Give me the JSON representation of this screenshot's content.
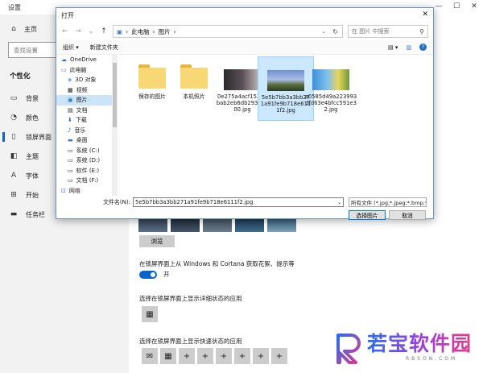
{
  "settings": {
    "title": "设置",
    "home": "主页",
    "search_placeholder": "查找设置",
    "section": "个性化",
    "nav": [
      {
        "label": "背景",
        "icon": "image-icon"
      },
      {
        "label": "颜色",
        "icon": "palette-icon"
      },
      {
        "label": "锁屏界面",
        "icon": "lock-screen-icon"
      },
      {
        "label": "主题",
        "icon": "theme-icon"
      },
      {
        "label": "字体",
        "icon": "font-icon"
      },
      {
        "label": "开始",
        "icon": "start-icon"
      },
      {
        "label": "任务栏",
        "icon": "taskbar-icon"
      }
    ],
    "browse": "浏览",
    "cortana_option": "在锁屏界面上从 Windows 和 Cortana 获取花絮、提示等",
    "toggle_state": "开",
    "detailed_status": "选择在锁屏界面上显示详细状态的应用",
    "quick_status": "选择在锁屏界面上显示快速状态的应用",
    "quick_slots": [
      "+",
      "+",
      "+",
      "+",
      "+",
      "+"
    ]
  },
  "dialog": {
    "title": "打开",
    "path": [
      "此电脑",
      "图片"
    ],
    "search_placeholder": "在 图片 中搜索",
    "organize": "组织 ▾",
    "new_folder": "新建文件夹",
    "nav_items": [
      {
        "label": "OneDrive",
        "icon": "cloud-icon"
      },
      {
        "label": "此电脑",
        "icon": "computer-icon"
      },
      {
        "label": "3D 对象",
        "icon": "cube-icon"
      },
      {
        "label": "视频",
        "icon": "video-icon"
      },
      {
        "label": "图片",
        "icon": "pictures-icon"
      },
      {
        "label": "文档",
        "icon": "document-icon"
      },
      {
        "label": "下载",
        "icon": "download-icon"
      },
      {
        "label": "音乐",
        "icon": "music-icon"
      },
      {
        "label": "桌面",
        "icon": "desktop-icon"
      },
      {
        "label": "系统 (C:)",
        "icon": "drive-icon"
      },
      {
        "label": "系统 (D:)",
        "icon": "drive-icon"
      },
      {
        "label": "软件 (E:)",
        "icon": "drive-icon"
      },
      {
        "label": "文档 (F:)",
        "icon": "drive-icon"
      },
      {
        "label": "网络",
        "icon": "network-icon"
      }
    ],
    "files": [
      {
        "name": "保存的图片",
        "type": "folder"
      },
      {
        "name": "本机照片",
        "type": "folder"
      },
      {
        "name": "0e275a4acf15273bab2eb6db2939a300.jpg",
        "type": "photo"
      },
      {
        "name": "5e5b7bb3a3bb271a91fe9b718e6111f2.jpg",
        "type": "photo",
        "selected": true
      },
      {
        "name": "a0585d49a223993dfd63e4bfcc591e32.jpg",
        "type": "photo"
      }
    ],
    "filename_label": "文件名(N):",
    "filename_value": "5e5b7bb3a3bb271a91fe9b718e6111f2.jpg",
    "filetype": "所有文件 (*.jpg;*.jpeg;*.bmp;*.",
    "ok": "选择图片",
    "cancel": "取消"
  },
  "brand": {
    "name": "若宝软件园",
    "url": "RBSON.COM"
  },
  "colors": {
    "accent": "#0a64c8",
    "selection": "#cce8ff",
    "folder": "#f8d775"
  }
}
